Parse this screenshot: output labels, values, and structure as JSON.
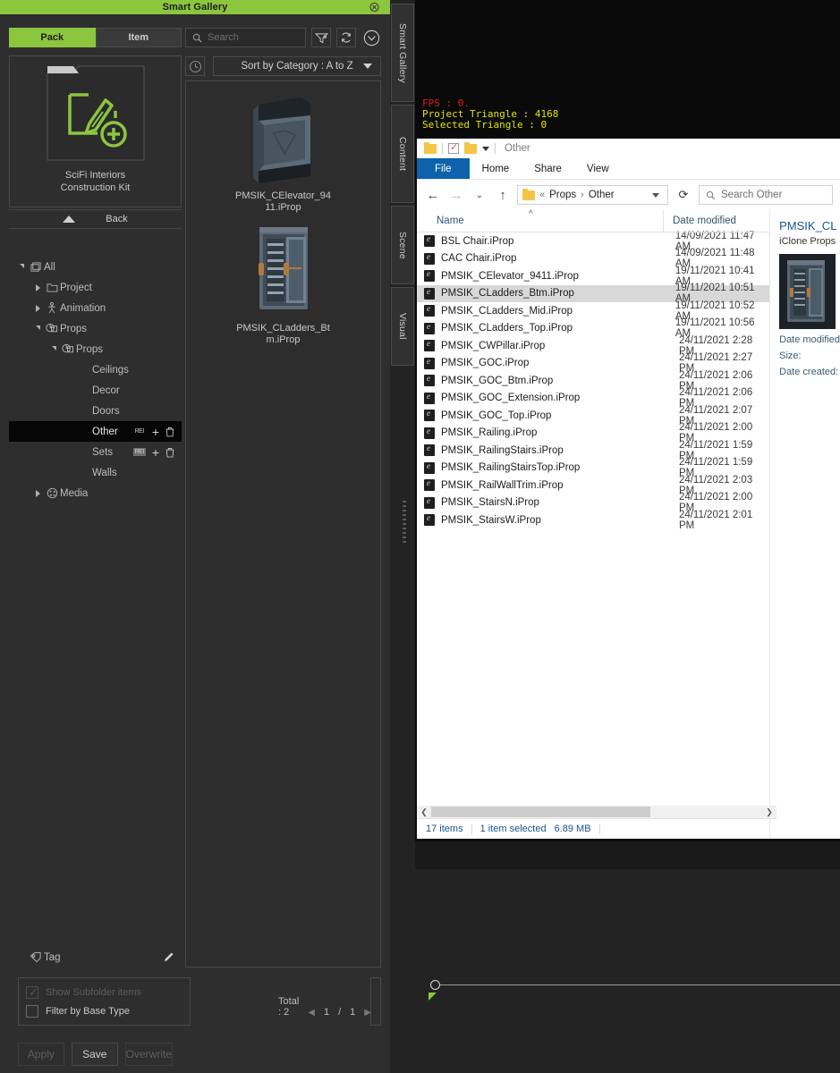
{
  "gallery": {
    "title": "Smart Gallery",
    "close_icon": "close-icon",
    "tabs": [
      {
        "label": "Pack",
        "active": true
      },
      {
        "label": "Item",
        "active": false
      }
    ],
    "pack": {
      "caption_line1": "SciFi Interiors",
      "caption_line2": "Construction Kit",
      "icon": "pack-create-icon"
    },
    "back_label": "Back",
    "tree": [
      {
        "label": "All",
        "indent": 0,
        "twisty": "down",
        "icon": "all-icon",
        "selected": false,
        "actions": false
      },
      {
        "label": "Project",
        "indent": 1,
        "twisty": "right",
        "icon": "folder-icon",
        "selected": false,
        "actions": false
      },
      {
        "label": "Animation",
        "indent": 1,
        "twisty": "right",
        "icon": "animation-icon",
        "selected": false,
        "actions": false
      },
      {
        "label": "Props",
        "indent": 1,
        "twisty": "down",
        "icon": "props-icon",
        "selected": false,
        "actions": false
      },
      {
        "label": "Props",
        "indent": 2,
        "twisty": "down",
        "icon": "props-icon",
        "selected": false,
        "actions": false
      },
      {
        "label": "Ceilings",
        "indent": 3,
        "twisty": "none",
        "icon": "none",
        "selected": false,
        "actions": false
      },
      {
        "label": "Decor",
        "indent": 3,
        "twisty": "none",
        "icon": "none",
        "selected": false,
        "actions": false
      },
      {
        "label": "Doors",
        "indent": 3,
        "twisty": "none",
        "icon": "none",
        "selected": false,
        "actions": false
      },
      {
        "label": "Other",
        "indent": 3,
        "twisty": "none",
        "icon": "none",
        "selected": true,
        "actions": true
      },
      {
        "label": "Sets",
        "indent": 3,
        "twisty": "none",
        "icon": "none",
        "selected": false,
        "actions": true,
        "rename_boxed": true
      },
      {
        "label": "Walls",
        "indent": 3,
        "twisty": "none",
        "icon": "none",
        "selected": false,
        "actions": false
      },
      {
        "label": "Media",
        "indent": 1,
        "twisty": "right",
        "icon": "media-icon",
        "selected": false,
        "actions": false
      }
    ],
    "tree_actions": {
      "rename": "RE",
      "add_icon": "plus-icon",
      "delete_icon": "trash-icon"
    },
    "tag_row": {
      "label": "Tag",
      "icon": "tag-icon",
      "edit_icon": "pencil-icon"
    },
    "search": {
      "placeholder": "Search",
      "icon": "search-icon"
    },
    "toolbar_icons": {
      "filter": "filter-icon",
      "refresh": "refresh-icon",
      "expand": "chevron-down-circle-icon",
      "recent": "clock-icon"
    },
    "sort": {
      "value": "Sort by Category : A to Z"
    },
    "thumbnails": [
      {
        "name": "PMSIK_CElevator_9411.iProp",
        "line1": "PMSIK_CElevator_94",
        "line2": "11.iProp",
        "thumb": "elevator-thumb"
      },
      {
        "name": "PMSIK_CLadders_Btm.iProp",
        "line1": "PMSIK_CLadders_Bt",
        "line2": "m.iProp",
        "thumb": "ladders-thumb"
      }
    ],
    "options": [
      {
        "label": "Show Subfolder items",
        "checked": true,
        "disabled": true
      },
      {
        "label": "Filter by Base Type",
        "checked": false,
        "disabled": false
      }
    ],
    "pagination": {
      "total_label": "Total : 2",
      "current": "1",
      "divider": "/",
      "pages": "1",
      "prev_icon": "chevron-left-icon",
      "next_icon": "chevron-right-icon"
    },
    "buttons": [
      {
        "label": "Apply",
        "disabled": true
      },
      {
        "label": "Save",
        "disabled": false
      },
      {
        "label": "Overwrite",
        "disabled": true
      }
    ]
  },
  "vertical_tabs": [
    {
      "label": "Smart Gallery"
    },
    {
      "label": "Content"
    },
    {
      "label": "Scene"
    },
    {
      "label": "Visual"
    }
  ],
  "viewport": {
    "stats": [
      {
        "text": "FPS : 0.",
        "color": "#d81f1f"
      },
      {
        "text": "Project Triangle : 4168",
        "color": "#e3e300"
      },
      {
        "text": "Selected Triangle : 0",
        "color": "#e3e300"
      }
    ]
  },
  "explorer": {
    "title": "Other",
    "quick_access": {
      "folder_icon": "folder-icon",
      "properties_icon": "properties-checkbox-icon",
      "new_folder_icon": "new-folder-icon",
      "customize_icon": "chevron-down-icon"
    },
    "ribbon_tabs": [
      {
        "label": "File",
        "active": true
      },
      {
        "label": "Home",
        "active": false
      },
      {
        "label": "Share",
        "active": false
      },
      {
        "label": "View",
        "active": false
      }
    ],
    "nav": {
      "back_icon": "arrow-left-icon",
      "forward_icon": "arrow-right-icon",
      "recent_icon": "chevron-down-icon",
      "up_icon": "arrow-up-icon",
      "refresh_icon": "refresh-icon",
      "breadcrumb_overflow": "«",
      "breadcrumbs": [
        "Props",
        "Other"
      ],
      "search_placeholder": "Search Other",
      "search_icon": "search-icon"
    },
    "columns": [
      {
        "label": "Name"
      },
      {
        "label": "Date modified"
      }
    ],
    "files": [
      {
        "name": "BSL Chair.iProp",
        "date": "14/09/2021 11:47 AM",
        "selected": false
      },
      {
        "name": "CAC Chair.iProp",
        "date": "14/09/2021 11:48 AM",
        "selected": false
      },
      {
        "name": "PMSIK_CElevator_9411.iProp",
        "date": "19/11/2021 10:41 AM",
        "selected": false
      },
      {
        "name": "PMSIK_CLadders_Btm.iProp",
        "date": "19/11/2021 10:51 AM",
        "selected": true
      },
      {
        "name": "PMSIK_CLadders_Mid.iProp",
        "date": "19/11/2021 10:52 AM",
        "selected": false
      },
      {
        "name": "PMSIK_CLadders_Top.iProp",
        "date": "19/11/2021 10:56 AM",
        "selected": false
      },
      {
        "name": "PMSIK_CWPillar.iProp",
        "date": "24/11/2021 2:28 PM",
        "selected": false
      },
      {
        "name": "PMSIK_GOC.iProp",
        "date": "24/11/2021 2:27 PM",
        "selected": false
      },
      {
        "name": "PMSIK_GOC_Btm.iProp",
        "date": "24/11/2021 2:06 PM",
        "selected": false
      },
      {
        "name": "PMSIK_GOC_Extension.iProp",
        "date": "24/11/2021 2:06 PM",
        "selected": false
      },
      {
        "name": "PMSIK_GOC_Top.iProp",
        "date": "24/11/2021 2:07 PM",
        "selected": false
      },
      {
        "name": "PMSIK_Railing.iProp",
        "date": "24/11/2021 2:00 PM",
        "selected": false
      },
      {
        "name": "PMSIK_RailingStairs.iProp",
        "date": "24/11/2021 1:59 PM",
        "selected": false
      },
      {
        "name": "PMSIK_RailingStairsTop.iProp",
        "date": "24/11/2021 1:59 PM",
        "selected": false
      },
      {
        "name": "PMSIK_RailWallTrim.iProp",
        "date": "24/11/2021 2:03 PM",
        "selected": false
      },
      {
        "name": "PMSIK_StairsN.iProp",
        "date": "24/11/2021 2:00 PM",
        "selected": false
      },
      {
        "name": "PMSIK_StairsW.iProp",
        "date": "24/11/2021 2:01 PM",
        "selected": false
      }
    ],
    "details": {
      "title": "PMSIK_CL",
      "type": "iClone Props",
      "thumb": "ladders-thumb",
      "fields": [
        "Date modified",
        "Size:",
        "Date created:"
      ]
    },
    "status": {
      "items_count": "17 items",
      "selection": "1 item selected",
      "size": "6.89 MB"
    },
    "scroll": {
      "left_icon": "chevron-left-icon",
      "right_icon": "chevron-right-icon"
    }
  },
  "colors": {
    "accent_green": "#8cc63f",
    "panel_bg": "#2e2e2e",
    "selection_black": "#060606",
    "explorer_accent": "#0d62ab",
    "stat_red": "#d81f1f",
    "stat_yellow": "#e3e300"
  }
}
